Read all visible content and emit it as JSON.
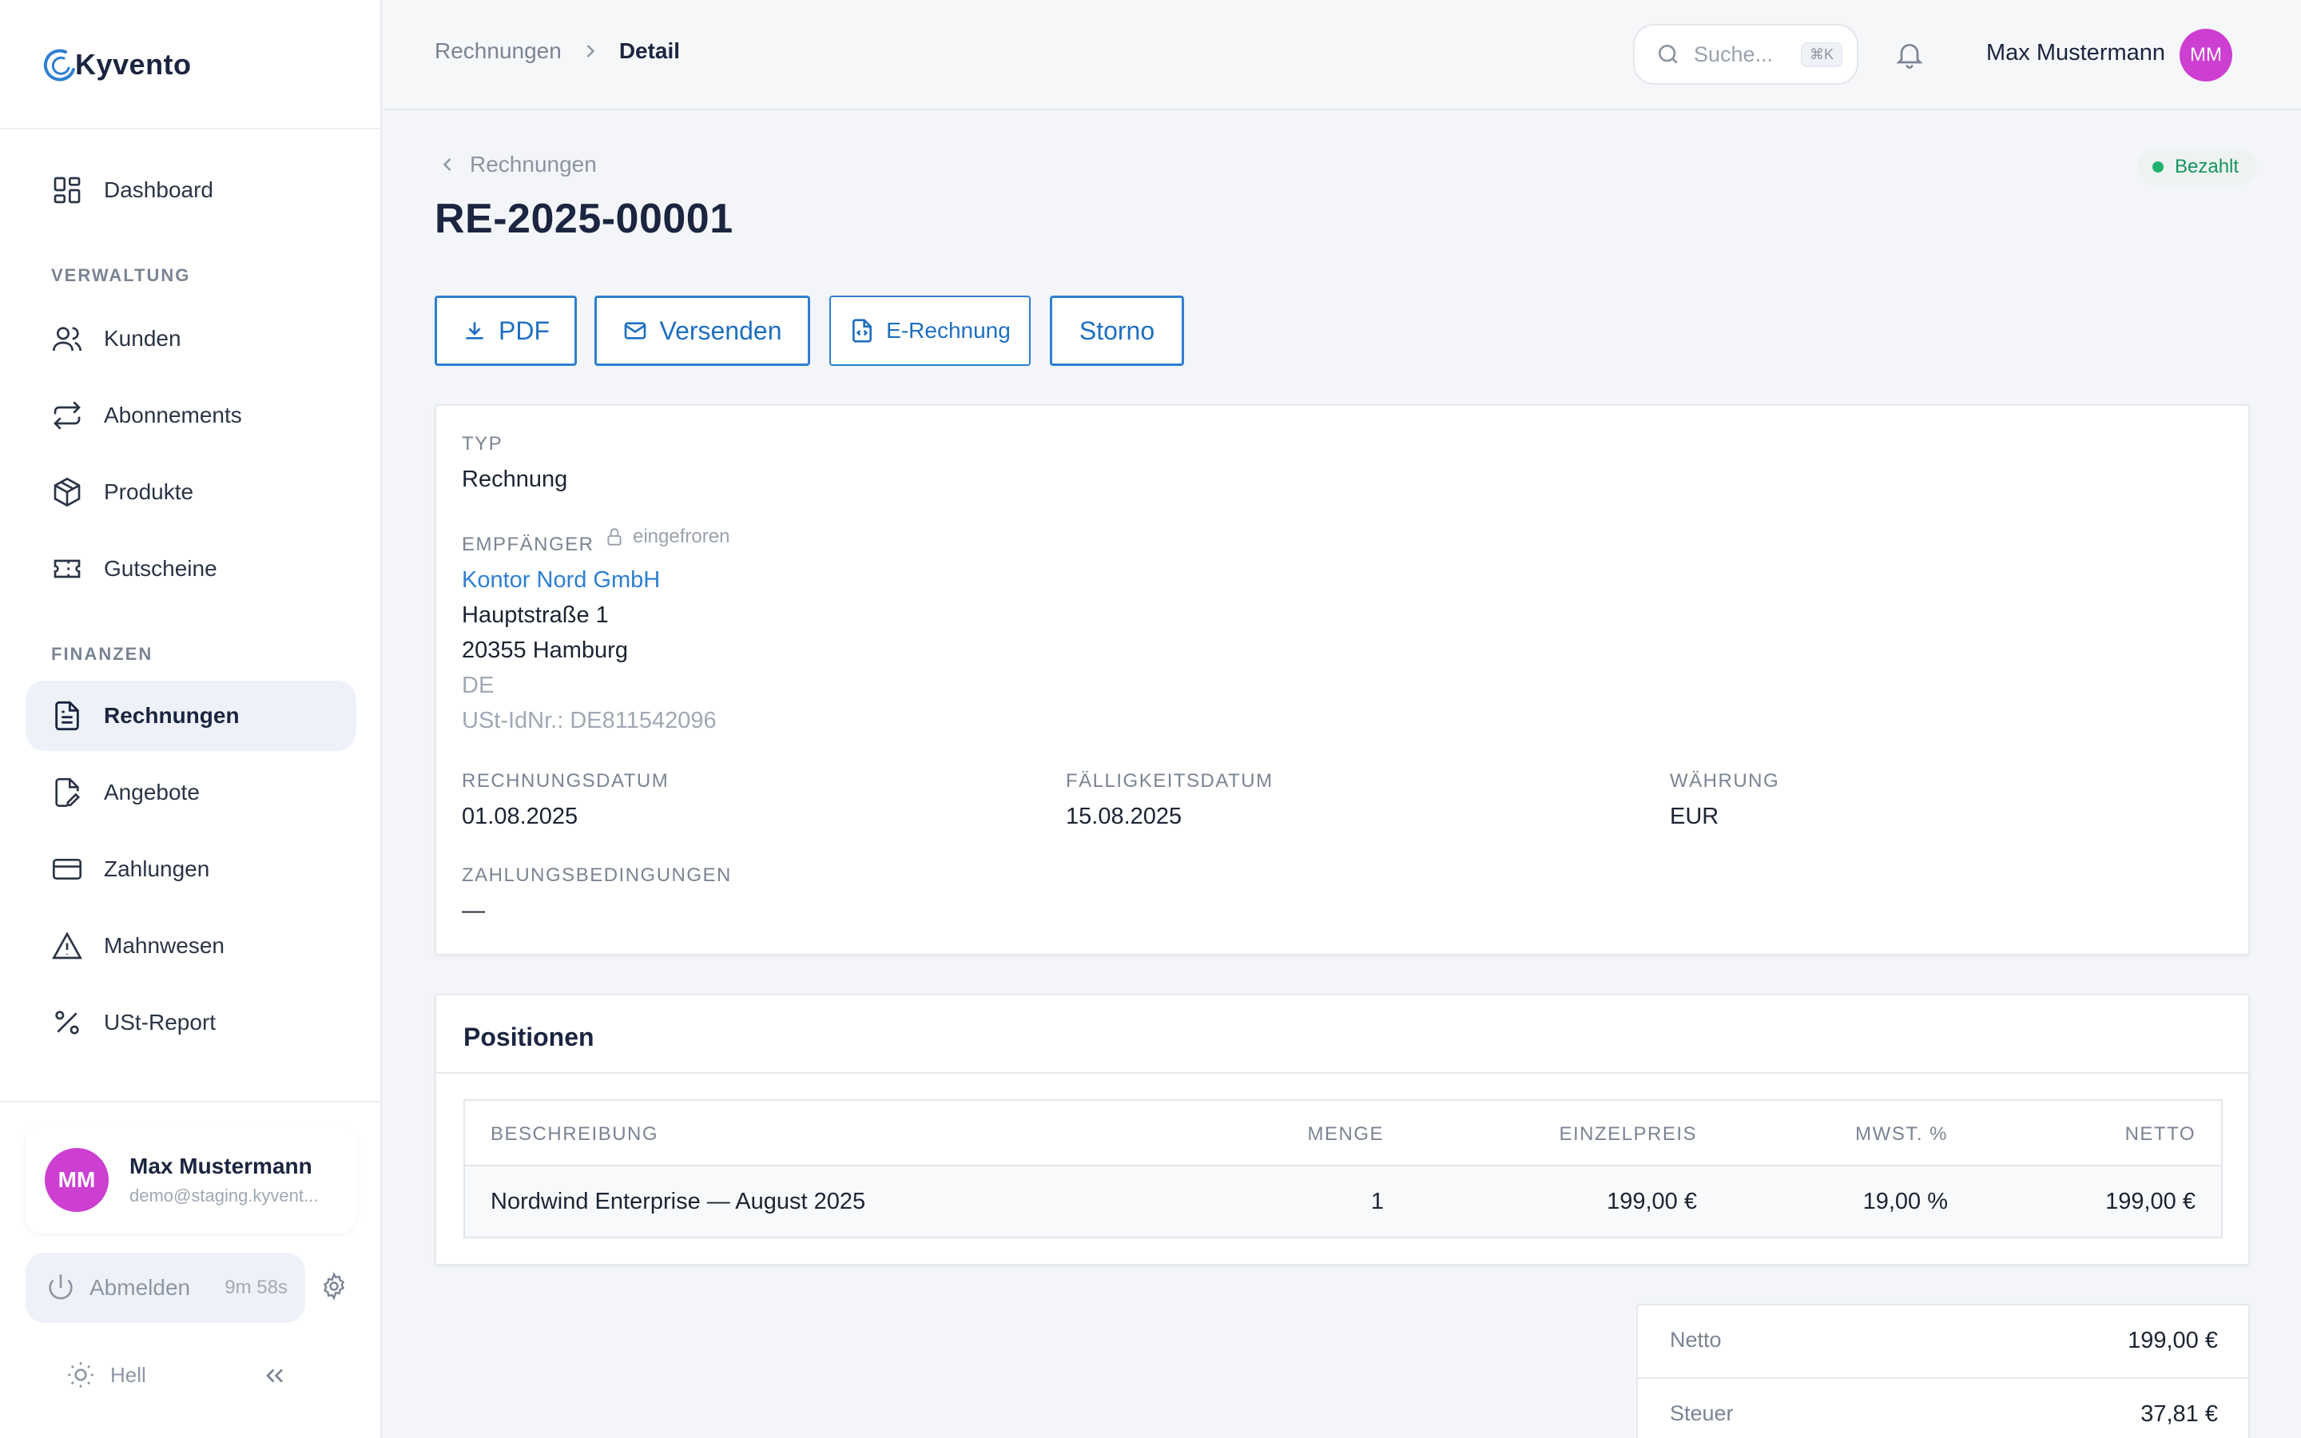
{
  "brand": {
    "name": "Kyvento",
    "logo_icon": "kyvento-logo"
  },
  "sidebar": {
    "dashboard": "Dashboard",
    "section_admin": "VERWALTUNG",
    "kunden": "Kunden",
    "abonnements": "Abonnements",
    "produkte": "Produkte",
    "gutscheine": "Gutscheine",
    "section_finance": "FINANZEN",
    "rechnungen": "Rechnungen",
    "angebote": "Angebote",
    "zahlungen": "Zahlungen",
    "mahnwesen": "Mahnwesen",
    "ust_report": "USt-Report",
    "user": {
      "initials": "MM",
      "name": "Max Mustermann",
      "email": "demo@staging.kyvent..."
    },
    "logout": {
      "label": "Abmelden",
      "timer": "9m 58s"
    },
    "theme": {
      "label": "Hell"
    }
  },
  "topbar": {
    "breadcrumb_parent": "Rechnungen",
    "breadcrumb_current": "Detail",
    "search_placeholder": "Suche...",
    "search_shortcut": "⌘K",
    "user_name": "Max Mustermann",
    "user_initials": "MM"
  },
  "invoice": {
    "back_label": "Rechnungen",
    "title": "RE-2025-00001",
    "status": "Bezahlt",
    "status_color": "#20b26d",
    "actions": {
      "pdf": "PDF",
      "send": "Versenden",
      "erechnung": "E-Rechnung",
      "storno": "Storno"
    },
    "labels": {
      "type": "TYP",
      "recipient": "EMPFÄNGER",
      "frozen": "eingefroren",
      "invoice_date": "RECHNUNGSDATUM",
      "due_date": "FÄLLIGKEITSDATUM",
      "currency": "WÄHRUNG",
      "payment_terms": "ZAHLUNGSBEDINGUNGEN"
    },
    "type": "Rechnung",
    "recipient": {
      "name": "Kontor Nord GmbH",
      "street": "Hauptstraße 1",
      "city": "20355 Hamburg",
      "country": "DE",
      "vat_id": "USt-IdNr.: DE811542096"
    },
    "invoice_date": "01.08.2025",
    "due_date": "15.08.2025",
    "currency": "EUR",
    "payment_terms": "—"
  },
  "positions": {
    "title": "Positionen",
    "columns": {
      "description": "BESCHREIBUNG",
      "qty": "MENGE",
      "unit_price": "EINZELPREIS",
      "vat": "MWST. %",
      "net": "NETTO"
    },
    "rows": [
      {
        "description": "Nordwind Enterprise — August 2025",
        "qty": "1",
        "unit_price": "199,00 €",
        "vat": "19,00 %",
        "net": "199,00 €"
      }
    ]
  },
  "totals": {
    "net_label": "Netto",
    "net_value": "199,00 €",
    "tax_label": "Steuer",
    "tax_value": "37,81 €"
  },
  "colors": {
    "accent": "#2f7fd0",
    "avatar": "#cc3fd0",
    "paid": "#15935f"
  }
}
